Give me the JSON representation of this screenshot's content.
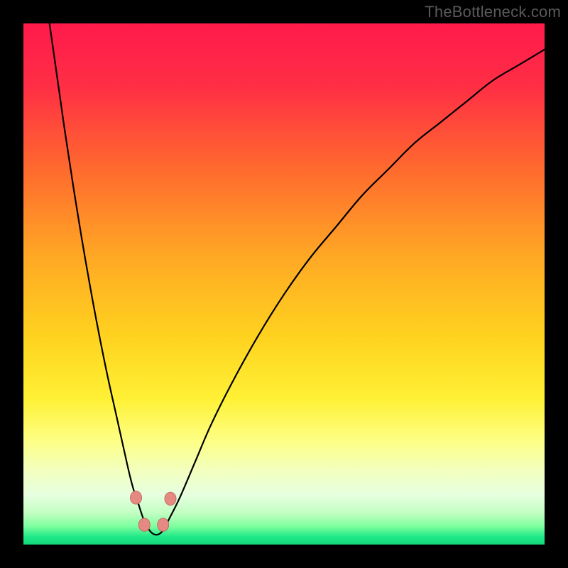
{
  "watermark": "TheBottleneck.com",
  "colors": {
    "background": "#000000",
    "watermark": "#5a5a5a",
    "gradient_stops": [
      {
        "offset": 0.0,
        "color": "#ff1a4b"
      },
      {
        "offset": 0.12,
        "color": "#ff2e45"
      },
      {
        "offset": 0.28,
        "color": "#ff6a2e"
      },
      {
        "offset": 0.45,
        "color": "#ffa924"
      },
      {
        "offset": 0.6,
        "color": "#ffd21f"
      },
      {
        "offset": 0.72,
        "color": "#fff135"
      },
      {
        "offset": 0.8,
        "color": "#fdff84"
      },
      {
        "offset": 0.86,
        "color": "#f2ffc0"
      },
      {
        "offset": 0.905,
        "color": "#e6ffe0"
      },
      {
        "offset": 0.94,
        "color": "#c2ffc2"
      },
      {
        "offset": 0.965,
        "color": "#7dff9e"
      },
      {
        "offset": 0.985,
        "color": "#1fe887"
      },
      {
        "offset": 1.0,
        "color": "#14d879"
      }
    ],
    "curve": "#000000",
    "marker_fill": "#e58a82",
    "marker_stroke": "#c86a63"
  },
  "chart_data": {
    "type": "line",
    "title": "",
    "xlabel": "",
    "ylabel": "",
    "xlim": [
      0,
      100
    ],
    "ylim": [
      0,
      100
    ],
    "curve": {
      "x": [
        5,
        6,
        7,
        8,
        10,
        12,
        14,
        16,
        18,
        20,
        21,
        22,
        23,
        24,
        25,
        26,
        27,
        28,
        30,
        33,
        36,
        40,
        45,
        50,
        55,
        60,
        65,
        70,
        75,
        80,
        85,
        90,
        95,
        100
      ],
      "y": [
        100,
        93,
        86,
        79,
        66,
        54,
        43,
        33,
        24,
        15,
        11,
        8,
        5,
        3,
        2,
        2,
        3,
        5,
        9,
        16,
        23,
        31,
        40,
        48,
        55,
        61,
        67,
        72,
        77,
        81,
        85,
        89,
        92,
        95
      ]
    },
    "markers": [
      {
        "x": 21.6,
        "y": 9.0
      },
      {
        "x": 23.2,
        "y": 3.8
      },
      {
        "x": 26.8,
        "y": 3.8
      },
      {
        "x": 28.2,
        "y": 8.8
      }
    ],
    "marker_radius_px": 8
  }
}
